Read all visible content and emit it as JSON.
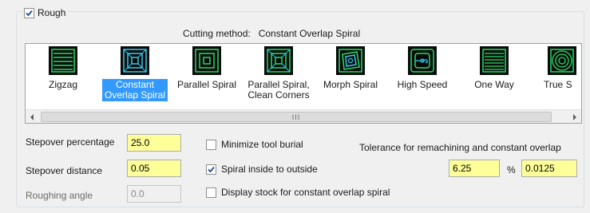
{
  "rough": {
    "label": "Rough",
    "checked": true
  },
  "cutting_method": {
    "label": "Cutting method:",
    "value": "Constant Overlap Spiral"
  },
  "strategies": [
    {
      "label": "Zigzag",
      "icon": "zigzag-icon",
      "selected": false
    },
    {
      "label": "Constant\nOverlap Spiral",
      "icon": "constant-overlap-spiral-icon",
      "selected": true
    },
    {
      "label": "Parallel Spiral",
      "icon": "parallel-spiral-icon",
      "selected": false
    },
    {
      "label": "Parallel Spiral,\nClean Corners",
      "icon": "parallel-spiral-clean-corners-icon",
      "selected": false
    },
    {
      "label": "Morph Spiral",
      "icon": "morph-spiral-icon",
      "selected": false
    },
    {
      "label": "High Speed",
      "icon": "high-speed-icon",
      "selected": false
    },
    {
      "label": "One Way",
      "icon": "one-way-icon",
      "selected": false
    },
    {
      "label": "True S",
      "icon": "true-spiral-icon",
      "selected": false
    }
  ],
  "scrollbar": {
    "thumb_grip": "III"
  },
  "fields": {
    "stepover_percentage": {
      "label": "Stepover percentage",
      "value": "25.0"
    },
    "stepover_distance": {
      "label": "Stepover distance",
      "value": "0.05"
    },
    "roughing_angle": {
      "label": "Roughing angle",
      "value": "0.0"
    }
  },
  "options": {
    "minimize_burial": {
      "label": "Minimize tool burial",
      "checked": false
    },
    "spiral_inside": {
      "label": "Spiral inside to outside",
      "checked": true
    },
    "display_stock": {
      "label": "Display stock for constant overlap spiral",
      "checked": false
    }
  },
  "tolerance": {
    "label": "Tolerance for remachining and constant overlap",
    "percent_value": "6.25",
    "percent_sign": "%",
    "abs_value": "0.0125"
  },
  "colors": {
    "input_bg": "#ffff99",
    "selection": "#3399ff",
    "icon_bg": "#0a0a0a",
    "icon_line": "#22dd66",
    "icon_cyan": "#33ccee"
  }
}
